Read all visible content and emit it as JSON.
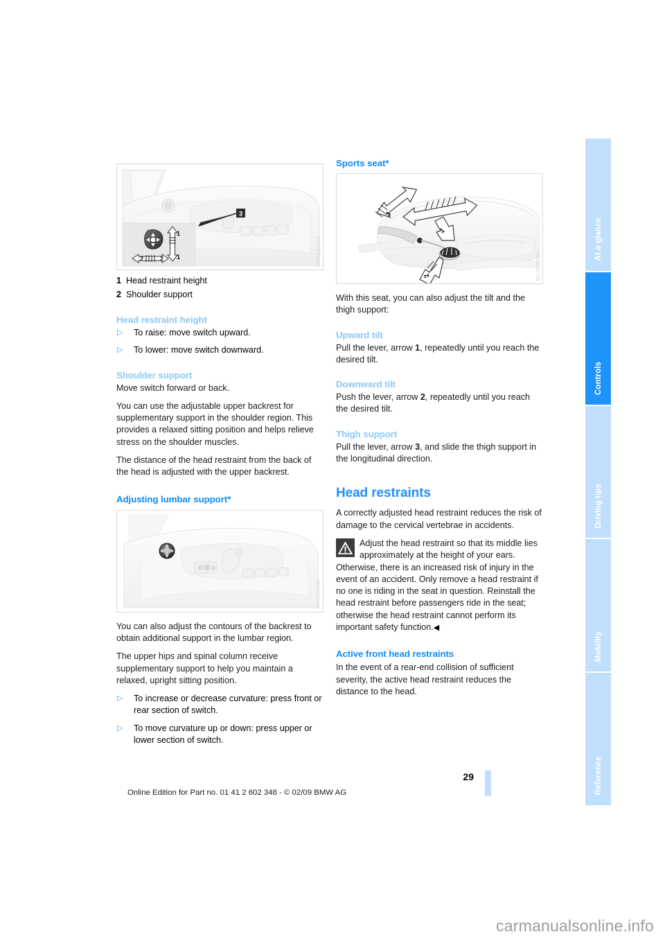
{
  "document": {
    "page_number": "29",
    "footer_note": "Online Edition for Part no. 01 41 2 602 348 - © 02/09 BMW AG",
    "watermark": "carmanualsonline.info"
  },
  "tabs": [
    {
      "label": "At a glance",
      "active": false
    },
    {
      "label": "Controls",
      "active": true
    },
    {
      "label": "Driving tips",
      "active": false
    },
    {
      "label": "Mobility",
      "active": false
    },
    {
      "label": "Reference",
      "active": false
    }
  ],
  "colors": {
    "heading_primary": "#1e90ff",
    "heading_secondary": "#0f8bf5",
    "heading_tertiary": "#8cc8f5",
    "tab_inactive": "#bfdffc",
    "tab_active": "#1e94fb",
    "bullet": "#3aa0f5"
  },
  "left_column": {
    "figure_seat_switch": {
      "alt": "Seat side control panel with inset detail of head restraint and shoulder support switch",
      "credit": "MFGB11CAA",
      "callouts": [
        "1",
        "2"
      ]
    },
    "legend": [
      {
        "number": "1",
        "text": "Head restraint height"
      },
      {
        "number": "2",
        "text": "Shoulder support"
      }
    ],
    "head_restraint_height": {
      "heading": "Head restraint height",
      "bullets": [
        "To raise: move switch upward.",
        "To lower: move switch downward."
      ]
    },
    "shoulder_support": {
      "heading": "Shoulder support",
      "paragraphs": [
        "Move switch forward or back.",
        "You can use the adjustable upper backrest for supplementary support in the shoulder region. This provides a relaxed sitting position and helps relieve stress on the shoulder muscles.",
        "The distance of the head restraint from the back of the head is adjusted with the upper backrest."
      ]
    },
    "lumbar_support": {
      "heading": "Adjusting lumbar support*",
      "figure": {
        "alt": "Seat side panel showing lumbar support switch",
        "credit": "MFGC02WA"
      },
      "paragraphs": [
        "You can also adjust the contours of the backrest to obtain additional support in the lumbar region.",
        "The upper hips and spinal column receive supplementary support to help you maintain a relaxed, upright sitting position."
      ],
      "bullets": [
        "To increase or decrease curvature: press front or rear section of switch.",
        "To move curvature up or down: press upper or lower section of switch."
      ]
    }
  },
  "right_column": {
    "sports_seat": {
      "heading": "Sports seat*",
      "figure": {
        "alt": "Sports seat with levers and directional arrows numbered 1, 2 and 3",
        "credit": "WC0HS0WA",
        "callouts": [
          "1",
          "2",
          "3"
        ]
      },
      "intro": "With this seat, you can also adjust the tilt and the thigh support:",
      "upward_tilt": {
        "heading": "Upward tilt",
        "text_before": "Pull the lever, arrow ",
        "arrow": "1",
        "text_after": ", repeatedly until you reach the desired tilt."
      },
      "downward_tilt": {
        "heading": "Downward tilt",
        "text_before": "Push the lever, arrow ",
        "arrow": "2",
        "text_after": ", repeatedly until you reach the desired tilt."
      },
      "thigh_support": {
        "heading": "Thigh support",
        "text_before": "Pull the lever, arrow ",
        "arrow": "3",
        "text_after": ", and slide the thigh support in the longitudinal direction."
      }
    },
    "head_restraints": {
      "heading": "Head restraints",
      "intro": "A correctly adjusted head restraint reduces the risk of damage to the cervical vertebrae in accidents.",
      "warning": {
        "icon": "warning-triangle-icon",
        "text": "Adjust the head restraint so that its middle lies approximately at the height of your ears. Otherwise, there is an increased risk of injury in the event of an accident. Only remove a head restraint if no one is riding in the seat in question. Reinstall the head restraint before passengers ride in the seat; otherwise the head restraint cannot perform its important safety function.",
        "end_mark": "◀"
      },
      "active_front": {
        "heading": "Active front head restraints",
        "text": "In the event of a rear-end collision of sufficient severity, the active head restraint reduces the distance to the head."
      }
    }
  }
}
